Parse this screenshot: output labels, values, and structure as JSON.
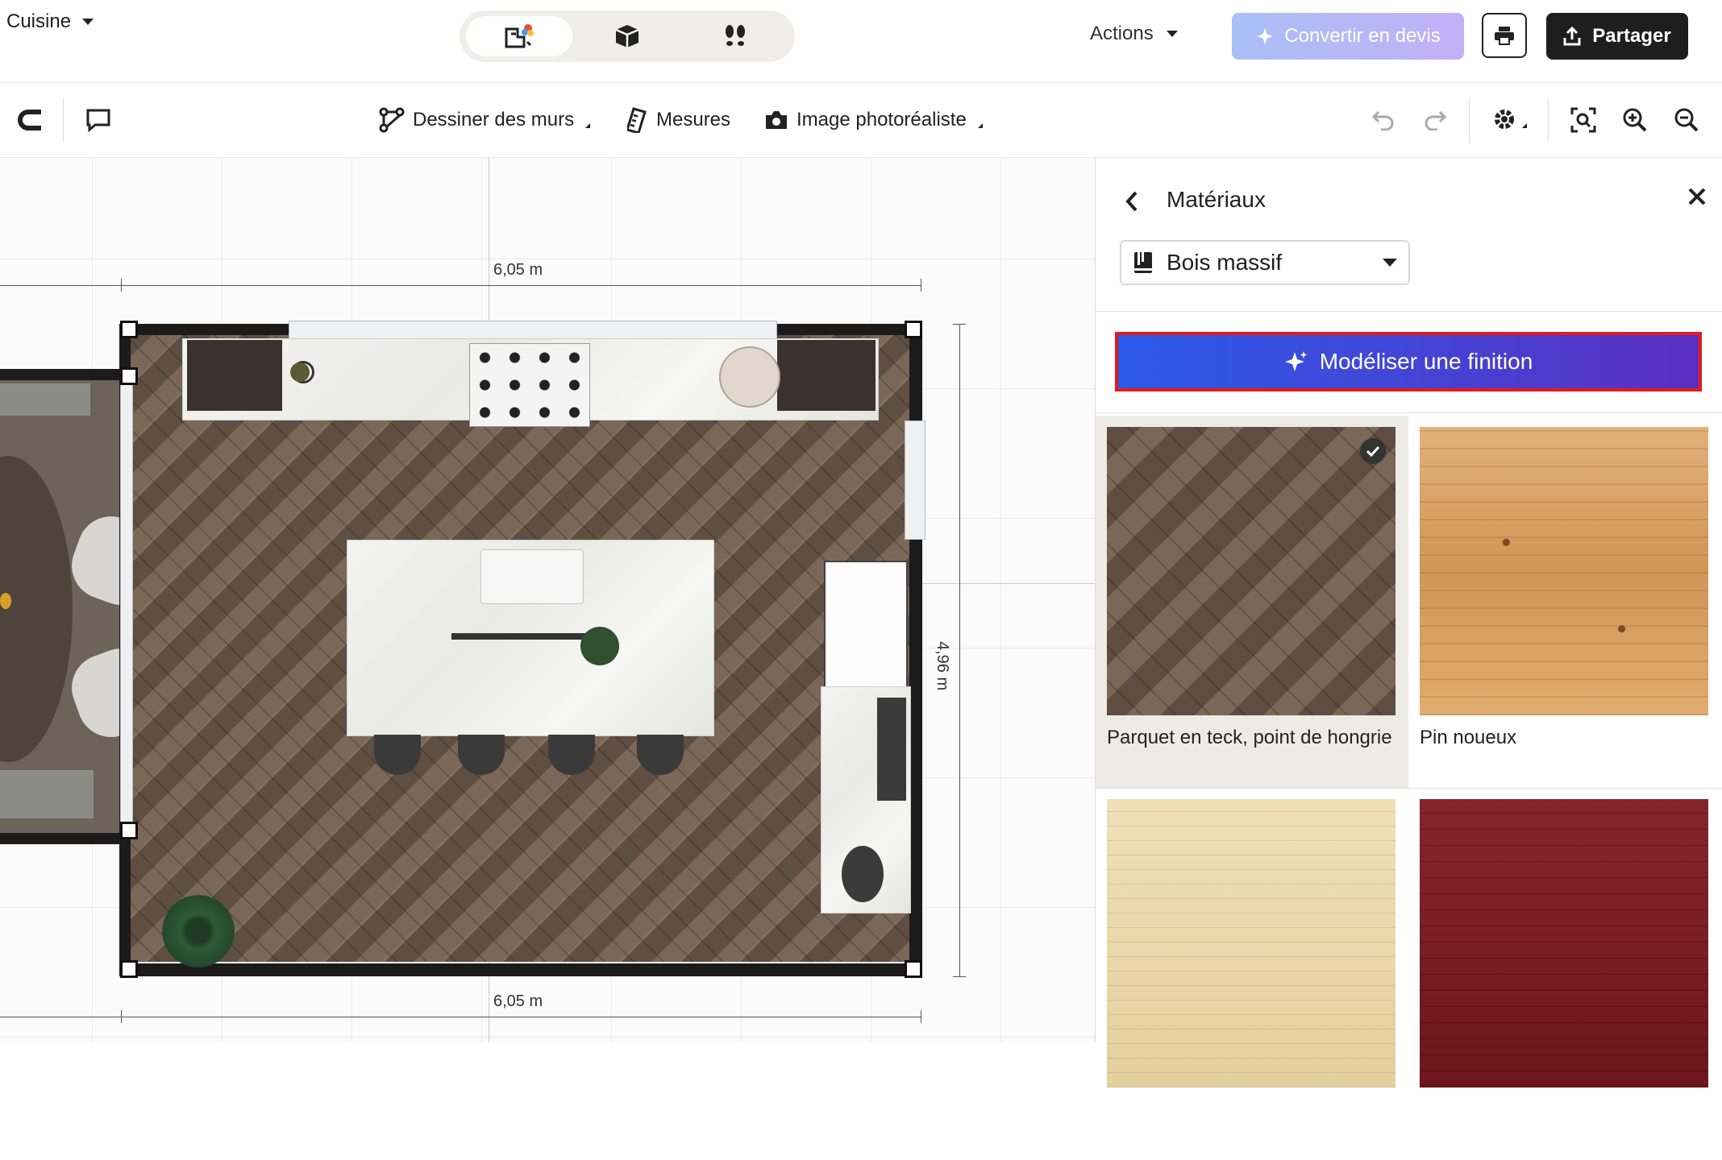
{
  "topbar": {
    "room_name": "Cuisine",
    "views": [
      {
        "name": "2d-plan-icon",
        "active": true
      },
      {
        "name": "3d-box-icon",
        "active": false
      },
      {
        "name": "walkthrough-footsteps-icon",
        "active": false
      }
    ],
    "actions_label": "Actions",
    "convert_label": "Convertir en devis",
    "share_label": "Partager"
  },
  "toolbar": {
    "draw_walls_label": "Dessiner des murs",
    "measures_label": "Mesures",
    "photo_label": "Image photoréaliste"
  },
  "canvas": {
    "dim_top": "6,05 m",
    "dim_bottom": "6,05 m",
    "dim_right": "4,96 m"
  },
  "panel": {
    "title": "Matériaux",
    "category": "Bois massif",
    "ai_button_label": "Modéliser une finition",
    "materials": [
      {
        "label": "Parquet en teck, point de hongrie",
        "selected": true,
        "color": "#6a5747"
      },
      {
        "label": "Pin noueux",
        "selected": false,
        "color": "#d9a566"
      },
      {
        "label": "",
        "selected": false,
        "color": "#ecd9ad"
      },
      {
        "label": "",
        "selected": false,
        "color": "#7a1e22"
      }
    ]
  },
  "colors": {
    "accent_gradient_start": "#2c5ae9",
    "accent_gradient_end": "#5a2fc2",
    "highlight_border": "#e21b1b",
    "dark_button": "#1e1e1e"
  }
}
